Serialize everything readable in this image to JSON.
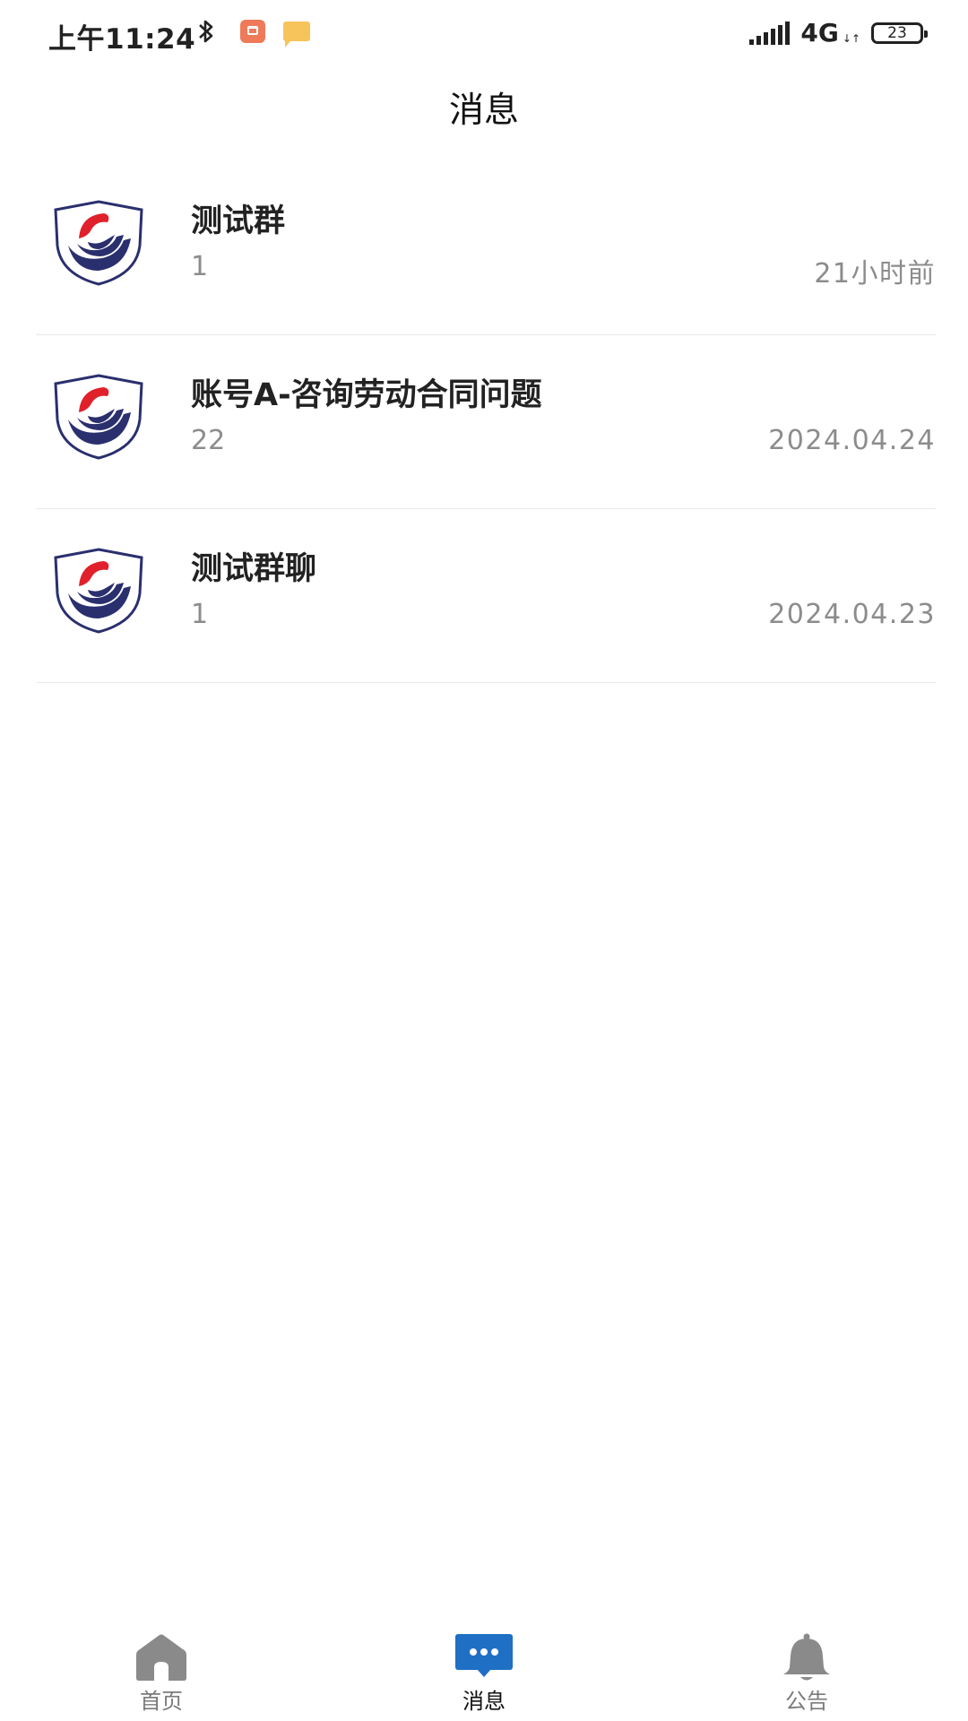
{
  "status_bar": {
    "time": "上午11:24",
    "network": "4G",
    "network_arrows": "↓↑",
    "battery": "23"
  },
  "header": {
    "title": "消息"
  },
  "messages": [
    {
      "title": "测试群",
      "preview": "1",
      "time": "21小时前"
    },
    {
      "title": "账号A-咨询劳动合同问题",
      "preview": "22",
      "time": "2024.04.24"
    },
    {
      "title": "测试群聊",
      "preview": "1",
      "time": "2024.04.23"
    }
  ],
  "tabbar": {
    "items": [
      {
        "label": "首页",
        "icon": "home-icon",
        "active": false
      },
      {
        "label": "消息",
        "icon": "chat-bubble-icon",
        "active": true
      },
      {
        "label": "公告",
        "icon": "bell-icon",
        "active": false
      }
    ]
  },
  "colors": {
    "accent": "#1f6fc5",
    "inactive_icon": "#8a8a8a",
    "logo_red": "#e0202a",
    "logo_navy": "#2a2f6e"
  }
}
